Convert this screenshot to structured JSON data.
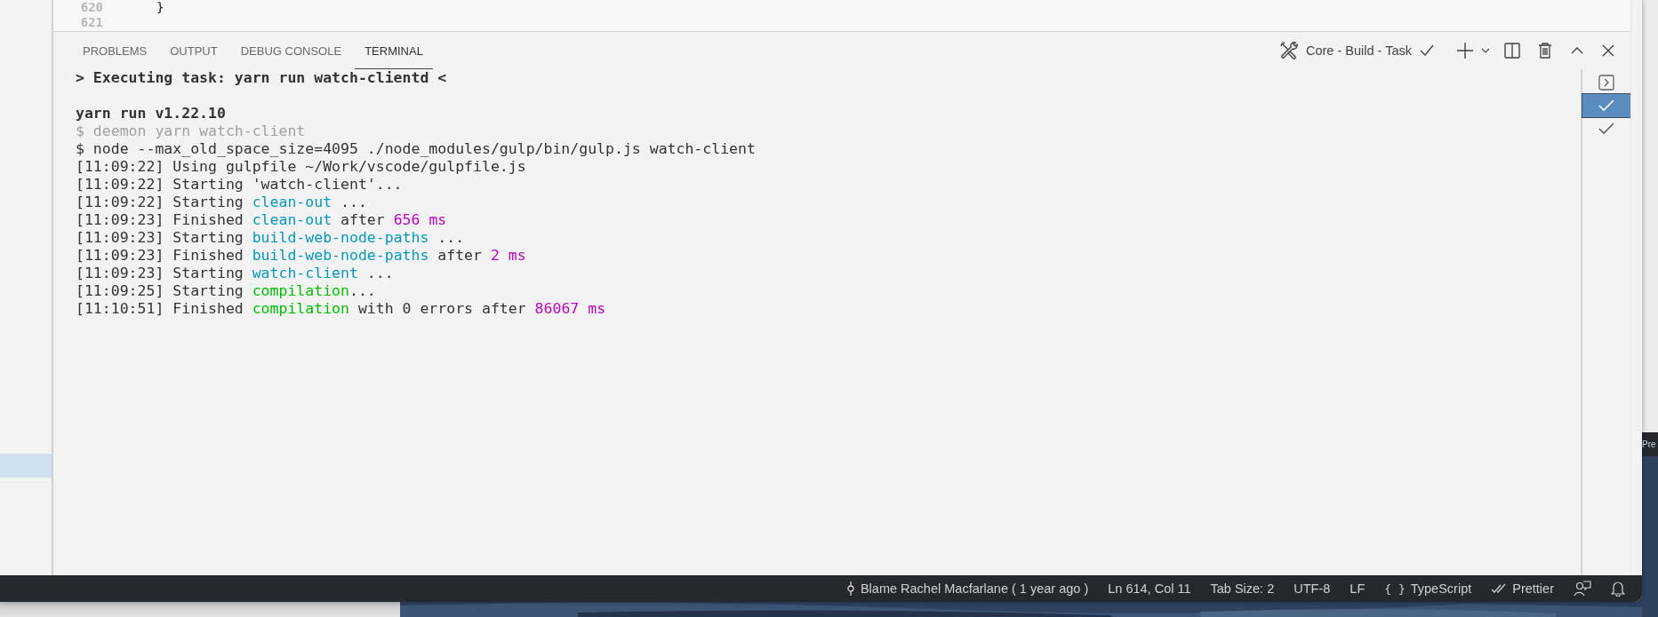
{
  "editor": {
    "lines": [
      {
        "number": "620",
        "code": "}"
      },
      {
        "number": "621"
      }
    ]
  },
  "sidebar": {
    "rows": [
      {
        "selected": false
      },
      {
        "selected": false
      },
      {
        "selected": false
      },
      {
        "selected": false
      },
      {
        "selected": false
      },
      {
        "selected": false
      },
      {
        "selected": false
      },
      {
        "selected": false
      },
      {
        "selected": false
      },
      {
        "selected": false
      },
      {
        "selected": false
      },
      {
        "selected": false
      },
      {
        "selected": false
      },
      {
        "selected": false
      },
      {
        "selected": false
      },
      {
        "selected": false
      },
      {
        "selected": false
      },
      {
        "selected": false
      },
      {
        "selected": true
      },
      {
        "selected": false
      }
    ]
  },
  "panel": {
    "tabs": [
      {
        "label": "PROBLEMS",
        "selected": false
      },
      {
        "label": "OUTPUT",
        "selected": false
      },
      {
        "label": "DEBUG CONSOLE",
        "selected": false
      },
      {
        "label": "TERMINAL",
        "selected": true
      }
    ],
    "task": {
      "label": "Core - Build - Task"
    },
    "terminal": {
      "header": "> Executing task: yarn run watch-clientd <",
      "lines": [
        {
          "segments": [
            {
              "text": "yarn run v1.22.10",
              "kind": "heading"
            }
          ]
        },
        {
          "segments": [
            {
              "text": "$ deemon yarn watch-client",
              "kind": "dim"
            }
          ]
        },
        {
          "segments": [
            {
              "text": "$ node --max_old_space_size=4095 ./node_modules/gulp/bin/gulp.js watch-client",
              "kind": "plain"
            }
          ]
        },
        {
          "segments": [
            {
              "text": "[11:09:22] Using gulpfile ~/Work/vscode/gulpfile.js",
              "kind": "plain"
            }
          ]
        },
        {
          "segments": [
            {
              "text": "[11:09:22] Starting 'watch-client'...",
              "kind": "plain"
            }
          ]
        },
        {
          "segments": [
            {
              "text": "[11:09:22] Starting ",
              "kind": "plain"
            },
            {
              "text": "clean-out",
              "kind": "task"
            },
            {
              "text": " ...",
              "kind": "plain"
            }
          ]
        },
        {
          "segments": [
            {
              "text": "[11:09:23] Finished ",
              "kind": "plain"
            },
            {
              "text": "clean-out",
              "kind": "task"
            },
            {
              "text": " after ",
              "kind": "plain"
            },
            {
              "text": "656 ms",
              "kind": "number"
            }
          ]
        },
        {
          "segments": [
            {
              "text": "[11:09:23] Starting ",
              "kind": "plain"
            },
            {
              "text": "build-web-node-paths",
              "kind": "task"
            },
            {
              "text": " ...",
              "kind": "plain"
            }
          ]
        },
        {
          "segments": [
            {
              "text": "[11:09:23] Finished ",
              "kind": "plain"
            },
            {
              "text": "build-web-node-paths",
              "kind": "task"
            },
            {
              "text": " after ",
              "kind": "plain"
            },
            {
              "text": "2 ms",
              "kind": "number"
            }
          ]
        },
        {
          "segments": [
            {
              "text": "[11:09:23] Starting ",
              "kind": "plain"
            },
            {
              "text": "watch-client",
              "kind": "task"
            },
            {
              "text": " ...",
              "kind": "plain"
            }
          ]
        },
        {
          "segments": [
            {
              "text": "[11:09:25] Starting ",
              "kind": "plain"
            },
            {
              "text": "compilation",
              "kind": "success"
            },
            {
              "text": "...",
              "kind": "plain"
            }
          ]
        },
        {
          "segments": [
            {
              "text": "[11:10:51] Finished ",
              "kind": "plain"
            },
            {
              "text": "compilation",
              "kind": "success"
            },
            {
              "text": " with 0 errors after ",
              "kind": "plain"
            },
            {
              "text": "86067 ms",
              "kind": "number"
            }
          ]
        }
      ]
    },
    "terminal_list": [
      {
        "kind": "shell",
        "selected": false
      },
      {
        "kind": "task",
        "selected": true
      },
      {
        "kind": "task",
        "selected": false
      }
    ]
  },
  "status_bar": {
    "items": [
      {
        "kind": "blame",
        "text": "Blame Rachel Macfarlane ( 1 year ago )"
      },
      {
        "kind": "text",
        "text": "Ln 614, Col 11"
      },
      {
        "kind": "text",
        "text": "Tab Size: 2"
      },
      {
        "kind": "text",
        "text": "UTF-8"
      },
      {
        "kind": "text",
        "text": "LF"
      },
      {
        "kind": "language",
        "glyph": "{ }",
        "text": "TypeScript"
      },
      {
        "kind": "formatter",
        "text": "Prettier"
      },
      {
        "kind": "feedback"
      },
      {
        "kind": "bell"
      }
    ]
  },
  "background_window": {
    "status_text": "Pre"
  }
}
